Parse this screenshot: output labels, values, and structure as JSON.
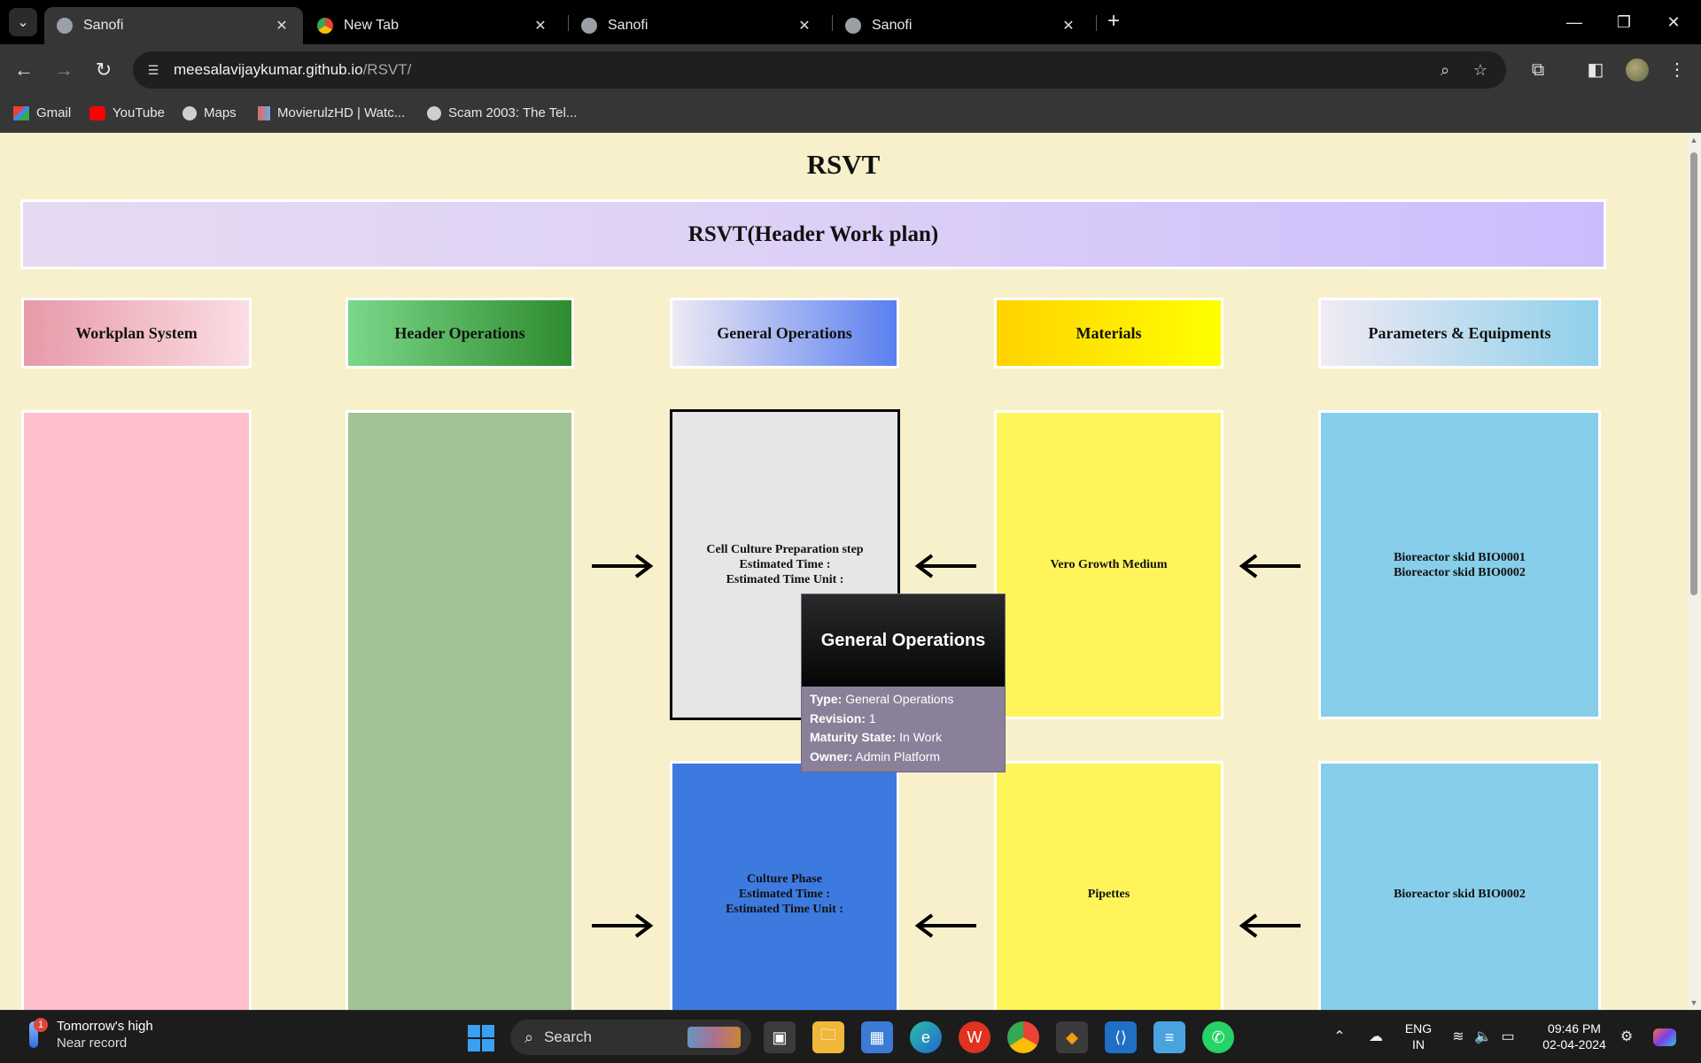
{
  "browser": {
    "tabs": [
      {
        "title": "Sanofi",
        "active": true
      },
      {
        "title": "New Tab",
        "active": false
      },
      {
        "title": "Sanofi",
        "active": false
      },
      {
        "title": "Sanofi",
        "active": false
      }
    ],
    "close_glyph": "✕",
    "url_host": "meesalavijaykumar.github.io",
    "url_path": "/RSVT/",
    "bookmarks": [
      {
        "label": "Gmail",
        "icon": "gmail-icon"
      },
      {
        "label": "YouTube",
        "icon": "youtube-icon"
      },
      {
        "label": "Maps",
        "icon": "globe-icon"
      },
      {
        "label": "MovierulzHD | Watc...",
        "icon": "movierulz-icon"
      },
      {
        "label": "Scam 2003: The Tel...",
        "icon": "globe-icon"
      }
    ]
  },
  "page": {
    "title": "RSVT",
    "header_banner": "RSVT(Header Work plan)",
    "columns": [
      {
        "label": "Workplan System",
        "colors": [
          "#e79aa8",
          "#fbdde2"
        ]
      },
      {
        "label": "Header Operations",
        "colors": [
          "#7ad88a",
          "#2e8b2e"
        ]
      },
      {
        "label": "General Operations",
        "colors": [
          "#eeeaf3",
          "#5a7ff0"
        ]
      },
      {
        "label": "Materials",
        "colors": [
          "#ffd200",
          "#ffff00"
        ]
      },
      {
        "label": "Parameters & Equipments",
        "colors": [
          "#f1eaf4",
          "#8fd0ea"
        ]
      }
    ],
    "row1": {
      "operation": "Cell Culture Preparation step\nEstimated Time :\nEstimated Time Unit :",
      "material": "Vero Growth Medium",
      "equipment": "Bioreactor skid BIO0001\nBioreactor skid BIO0002"
    },
    "row2": {
      "operation": "Culture Phase\nEstimated Time :\nEstimated Time Unit :",
      "material": "Pipettes",
      "equipment": "Bioreactor skid BIO0002"
    },
    "box_colors": {
      "workplan": "#ffc0cb",
      "header_ops": "#a1c396",
      "general_ops_selected": "#e6e6e6",
      "general_ops": "#3c7ae0",
      "materials": "#fff55a",
      "equipment": "#87ceeb"
    },
    "tooltip": {
      "title": "General Operations",
      "type_label": "Type:",
      "type_value": "General Operations",
      "revision_label": "Revision:",
      "revision_value": "1",
      "maturity_label": "Maturity State:",
      "maturity_value": "In Work",
      "owner_label": "Owner:",
      "owner_value": "Admin Platform"
    }
  },
  "taskbar": {
    "weather_title": "Tomorrow's high",
    "weather_sub": "Near record",
    "weather_badge": "1",
    "search_label": "Search",
    "lang_line1": "ENG",
    "lang_line2": "IN",
    "time": "09:46 PM",
    "date": "02-04-2024",
    "pinned_apps": [
      "task-view",
      "file-explorer",
      "microsoft-store",
      "edge",
      "wps-office",
      "chrome",
      "app-orange",
      "vscode",
      "notepad",
      "whatsapp"
    ]
  }
}
